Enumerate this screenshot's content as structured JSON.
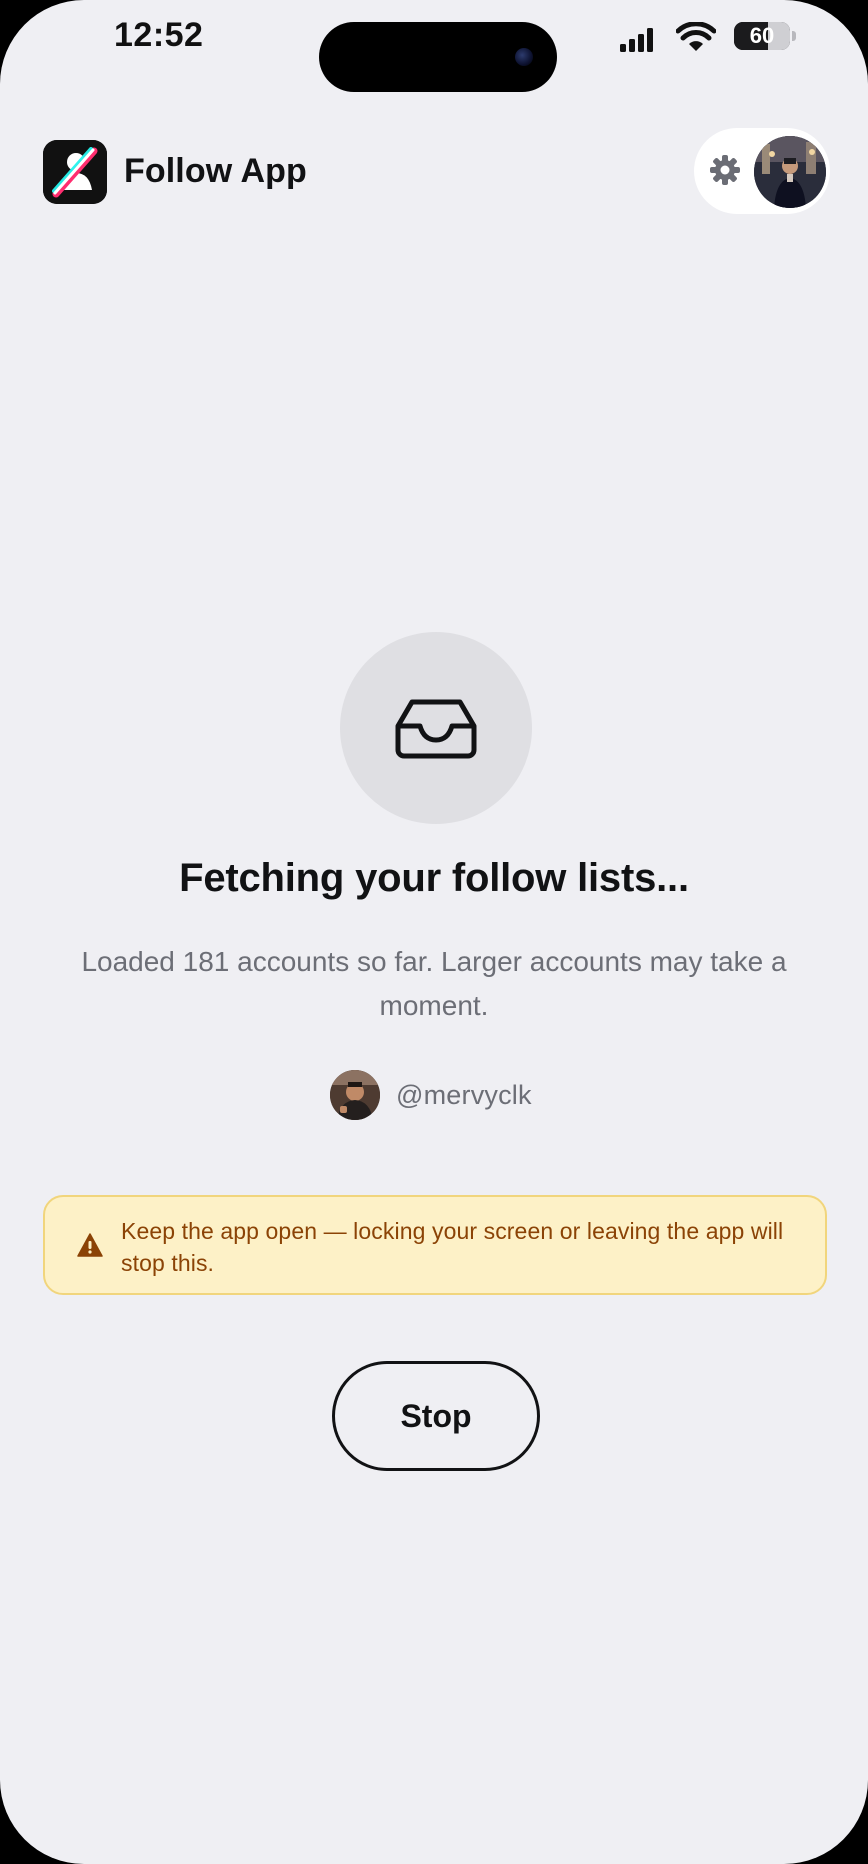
{
  "status_bar": {
    "time": "12:52",
    "battery_text": "60",
    "battery_level_percent": 60,
    "signal_icon": "signal-icon",
    "wifi_icon": "wifi-icon",
    "battery_icon": "battery-icon"
  },
  "header": {
    "app_title": "Follow App",
    "app_logo_icon": "app-logo-icon",
    "settings_icon": "gear-icon",
    "profile_avatar": "profile-avatar"
  },
  "loading_state": {
    "icon": "inbox-tray-icon",
    "title": "Fetching your follow lists...",
    "description": "Loaded 181 accounts so far. Larger accounts may take a moment.",
    "accounts_loaded": 181
  },
  "current_user": {
    "handle": "@mervyclk",
    "avatar": "user-avatar"
  },
  "warning": {
    "icon": "warning-triangle-icon",
    "text": "Keep the app open — locking your screen or leaving the app will stop this."
  },
  "actions": {
    "stop_label": "Stop"
  },
  "colors": {
    "background": "#efeff3",
    "warning_background": "#fdf1c7",
    "warning_border": "#f1d57c",
    "warning_text": "#8b4306",
    "primary_text": "#111214",
    "secondary_text": "#6c6e76"
  }
}
